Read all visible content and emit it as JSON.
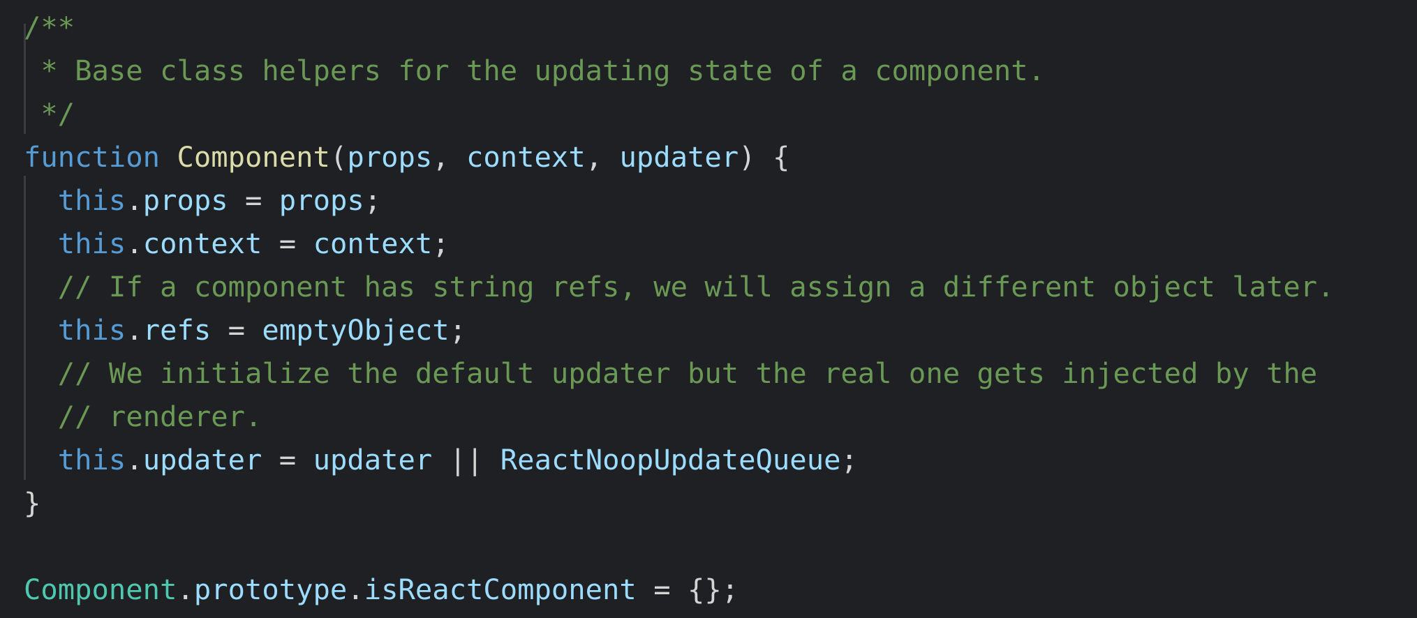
{
  "colors": {
    "background": "#1f2023",
    "comment": "#6a9955",
    "keyword": "#569cd6",
    "function_name": "#dcdcaa",
    "variable": "#9cdcfe",
    "class_name": "#4ec9b0",
    "punctuation": "#d4d4d4",
    "indent_guide": "#3b3c40"
  },
  "lines": [
    [
      {
        "t": "/**",
        "c": "#6a9955"
      }
    ],
    [
      {
        "t": " * Base class helpers for the updating state of a component.",
        "c": "#6a9955"
      }
    ],
    [
      {
        "t": " */",
        "c": "#6a9955"
      }
    ],
    [
      {
        "t": "function",
        "c": "#569cd6"
      },
      {
        "t": " ",
        "c": "#d4d4d4"
      },
      {
        "t": "Component",
        "c": "#dcdcaa"
      },
      {
        "t": "(",
        "c": "#d4d4d4"
      },
      {
        "t": "props",
        "c": "#9cdcfe"
      },
      {
        "t": ", ",
        "c": "#d4d4d4"
      },
      {
        "t": "context",
        "c": "#9cdcfe"
      },
      {
        "t": ", ",
        "c": "#d4d4d4"
      },
      {
        "t": "updater",
        "c": "#9cdcfe"
      },
      {
        "t": ") {",
        "c": "#d4d4d4"
      }
    ],
    [
      {
        "t": "  ",
        "c": "#d4d4d4"
      },
      {
        "t": "this",
        "c": "#569cd6"
      },
      {
        "t": ".",
        "c": "#d4d4d4"
      },
      {
        "t": "props",
        "c": "#9cdcfe"
      },
      {
        "t": " = ",
        "c": "#d4d4d4"
      },
      {
        "t": "props",
        "c": "#9cdcfe"
      },
      {
        "t": ";",
        "c": "#d4d4d4"
      }
    ],
    [
      {
        "t": "  ",
        "c": "#d4d4d4"
      },
      {
        "t": "this",
        "c": "#569cd6"
      },
      {
        "t": ".",
        "c": "#d4d4d4"
      },
      {
        "t": "context",
        "c": "#9cdcfe"
      },
      {
        "t": " = ",
        "c": "#d4d4d4"
      },
      {
        "t": "context",
        "c": "#9cdcfe"
      },
      {
        "t": ";",
        "c": "#d4d4d4"
      }
    ],
    [
      {
        "t": "  ",
        "c": "#d4d4d4"
      },
      {
        "t": "// If a component has string refs, we will assign a different object later.",
        "c": "#6a9955"
      }
    ],
    [
      {
        "t": "  ",
        "c": "#d4d4d4"
      },
      {
        "t": "this",
        "c": "#569cd6"
      },
      {
        "t": ".",
        "c": "#d4d4d4"
      },
      {
        "t": "refs",
        "c": "#9cdcfe"
      },
      {
        "t": " = ",
        "c": "#d4d4d4"
      },
      {
        "t": "emptyObject",
        "c": "#9cdcfe"
      },
      {
        "t": ";",
        "c": "#d4d4d4"
      }
    ],
    [
      {
        "t": "  ",
        "c": "#d4d4d4"
      },
      {
        "t": "// We initialize the default updater but the real one gets injected by the",
        "c": "#6a9955"
      }
    ],
    [
      {
        "t": "  ",
        "c": "#d4d4d4"
      },
      {
        "t": "// renderer.",
        "c": "#6a9955"
      }
    ],
    [
      {
        "t": "  ",
        "c": "#d4d4d4"
      },
      {
        "t": "this",
        "c": "#569cd6"
      },
      {
        "t": ".",
        "c": "#d4d4d4"
      },
      {
        "t": "updater",
        "c": "#9cdcfe"
      },
      {
        "t": " = ",
        "c": "#d4d4d4"
      },
      {
        "t": "updater",
        "c": "#9cdcfe"
      },
      {
        "t": " || ",
        "c": "#d4d4d4"
      },
      {
        "t": "ReactNoopUpdateQueue",
        "c": "#9cdcfe"
      },
      {
        "t": ";",
        "c": "#d4d4d4"
      }
    ],
    [
      {
        "t": "}",
        "c": "#d4d4d4"
      }
    ],
    [
      {
        "t": "",
        "c": "#d4d4d4"
      }
    ],
    [
      {
        "t": "Component",
        "c": "#4ec9b0"
      },
      {
        "t": ".",
        "c": "#d4d4d4"
      },
      {
        "t": "prototype",
        "c": "#9cdcfe"
      },
      {
        "t": ".",
        "c": "#d4d4d4"
      },
      {
        "t": "isReactComponent",
        "c": "#9cdcfe"
      },
      {
        "t": " = {};",
        "c": "#d4d4d4"
      }
    ]
  ]
}
